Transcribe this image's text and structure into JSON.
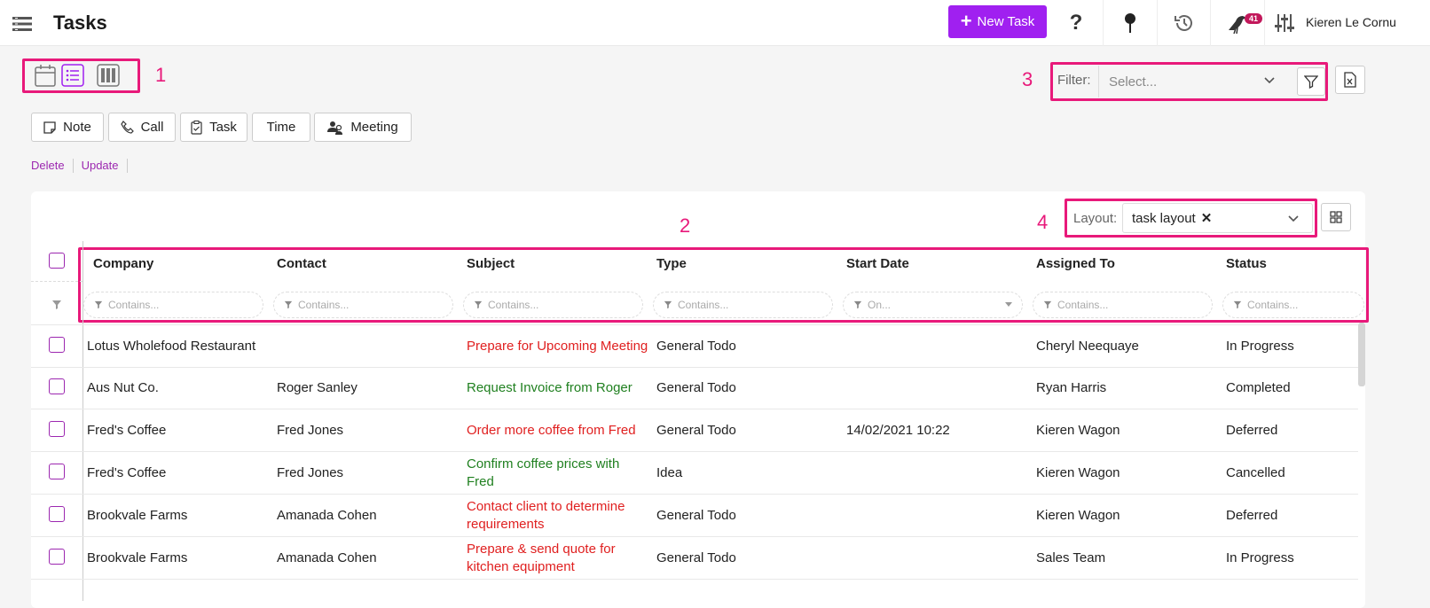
{
  "header": {
    "title": "Tasks",
    "new_task_label": "New Task",
    "notification_count": "41",
    "user_name": "Kieren Le Cornu"
  },
  "annotations": [
    "1",
    "2",
    "3",
    "4"
  ],
  "filter": {
    "label": "Filter:",
    "placeholder": "Select..."
  },
  "actions": {
    "note": "Note",
    "call": "Call",
    "task": "Task",
    "time": "Time",
    "meeting": "Meeting"
  },
  "links": {
    "delete": "Delete",
    "update": "Update"
  },
  "layout": {
    "label": "Layout:",
    "value": "task layout"
  },
  "columns": [
    {
      "header": "Company",
      "filter_placeholder": "Contains..."
    },
    {
      "header": "Contact",
      "filter_placeholder": "Contains..."
    },
    {
      "header": "Subject",
      "filter_placeholder": "Contains..."
    },
    {
      "header": "Type",
      "filter_placeholder": "Contains..."
    },
    {
      "header": "Start Date",
      "filter_placeholder": "On..."
    },
    {
      "header": "Assigned To",
      "filter_placeholder": "Contains..."
    },
    {
      "header": "Status",
      "filter_placeholder": "Contains..."
    }
  ],
  "rows": [
    {
      "company": "Lotus Wholefood Restaurant",
      "contact": "",
      "subject": "Prepare for Upcoming Meeting",
      "subject_color": "red",
      "type": "General Todo",
      "start_date": "",
      "assigned_to": "Cheryl Neequaye",
      "status": "In Progress"
    },
    {
      "company": "Aus Nut Co.",
      "contact": "Roger Sanley",
      "subject": "Request Invoice from Roger",
      "subject_color": "green",
      "type": "General Todo",
      "start_date": "",
      "assigned_to": "Ryan Harris",
      "status": "Completed"
    },
    {
      "company": "Fred's Coffee",
      "contact": "Fred Jones",
      "subject": "Order more coffee from Fred",
      "subject_color": "red",
      "type": "General Todo",
      "start_date": "14/02/2021 10:22",
      "assigned_to": "Kieren Wagon",
      "status": "Deferred"
    },
    {
      "company": "Fred's Coffee",
      "contact": "Fred Jones",
      "subject": "Confirm coffee prices with Fred",
      "subject_color": "green",
      "type": "Idea",
      "start_date": "",
      "assigned_to": "Kieren Wagon",
      "status": "Cancelled"
    },
    {
      "company": "Brookvale Farms",
      "contact": "Amanada Cohen",
      "subject": "Contact client to determine requirements",
      "subject_color": "red",
      "type": "General Todo",
      "start_date": "",
      "assigned_to": "Kieren Wagon",
      "status": "Deferred"
    },
    {
      "company": "Brookvale Farms",
      "contact": "Amanada Cohen",
      "subject": "Prepare & send quote for kitchen equipment",
      "subject_color": "red",
      "type": "General Todo",
      "start_date": "",
      "assigned_to": "Sales Team",
      "status": "In Progress"
    }
  ],
  "colors": {
    "accent": "#a020f0",
    "annotation": "#e8197a",
    "overdue": "#e02020",
    "done": "#208020"
  }
}
